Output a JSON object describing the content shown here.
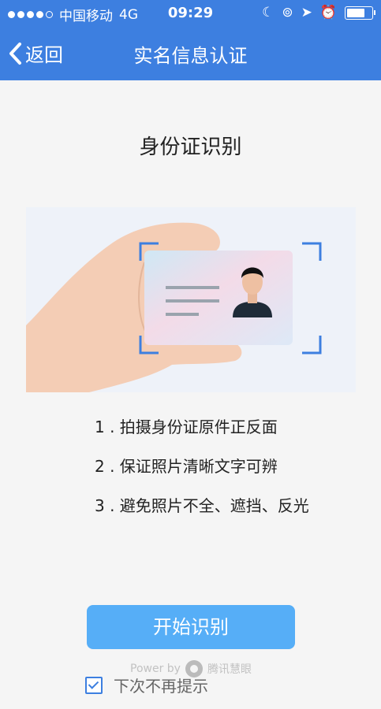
{
  "status_bar": {
    "carrier": "中国移动",
    "network": "4G",
    "time": "09:29"
  },
  "nav": {
    "back_label": "返回",
    "title": "实名信息认证"
  },
  "heading": "身份证识别",
  "steps": [
    "1 . 拍摄身份证原件正反面",
    "2 . 保证照片清晰文字可辨",
    "3 . 避免照片不全、遮挡、反光"
  ],
  "start_button": "开始识别",
  "watermark": {
    "power_by": "Power by",
    "brand": "腾讯慧眼"
  },
  "checkbox_label": "下次不再提示",
  "checkbox_checked": true,
  "colors": {
    "primary": "#3d7fe0",
    "button": "#56aef7"
  }
}
